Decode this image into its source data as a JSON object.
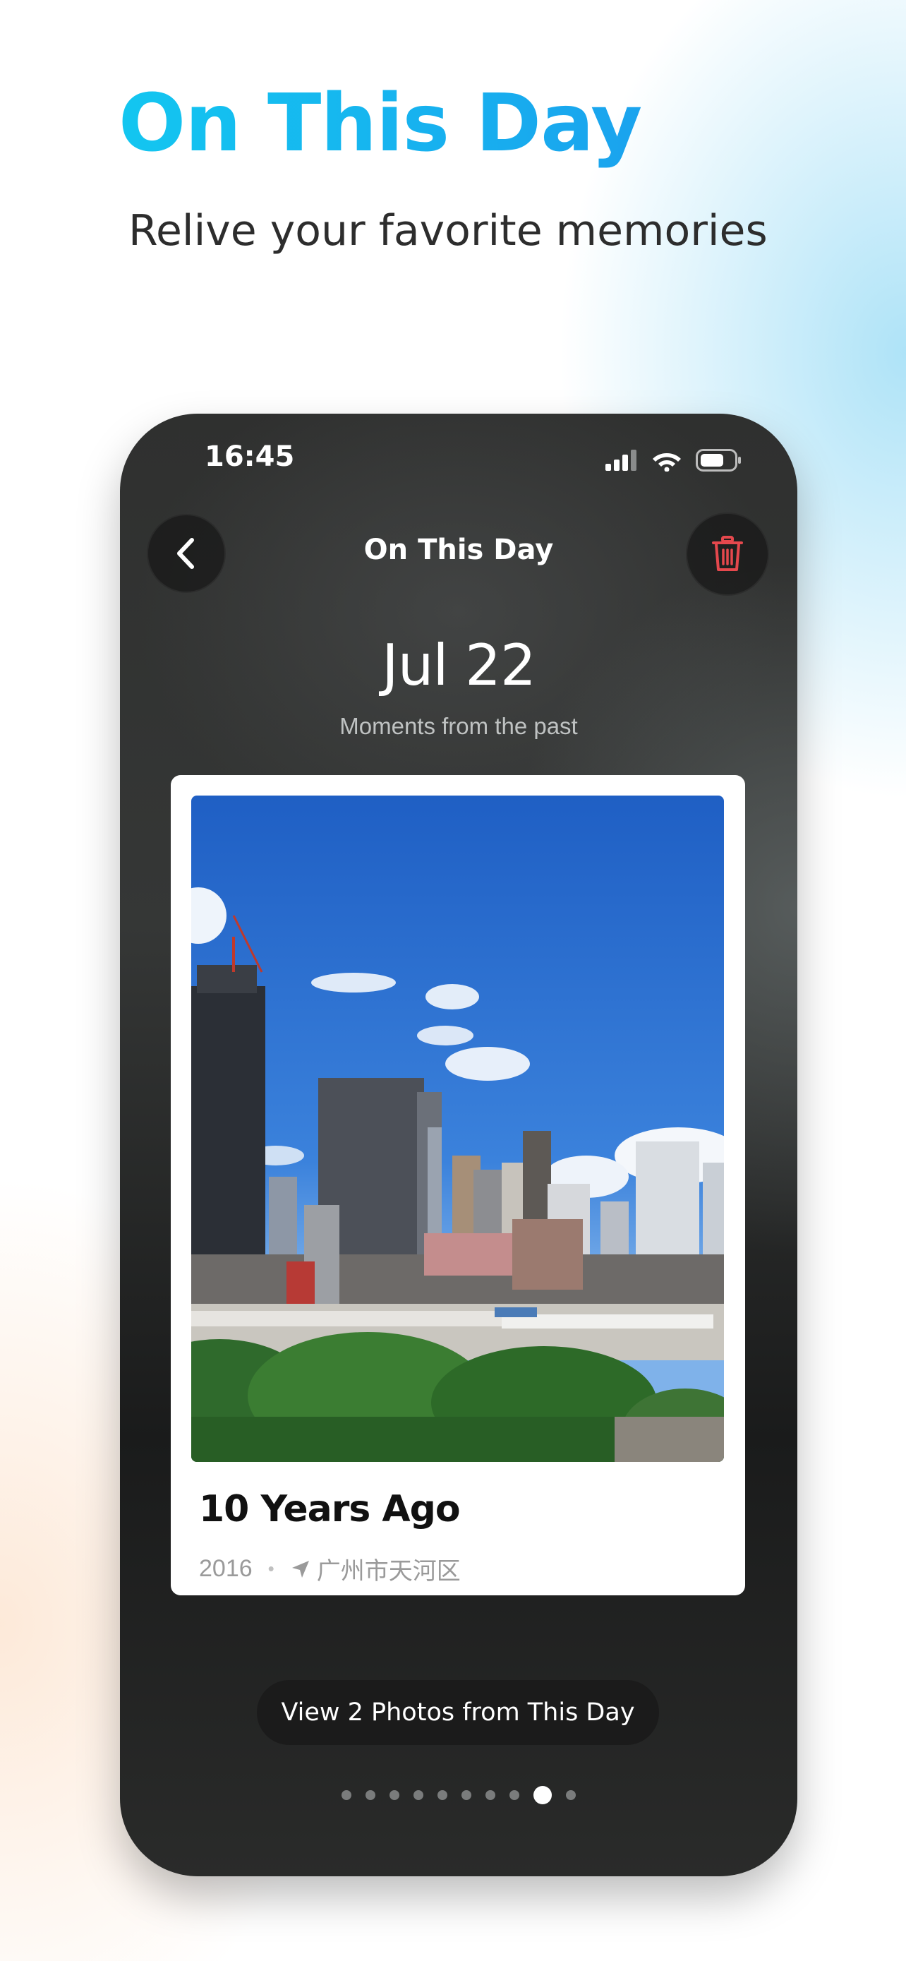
{
  "promo": {
    "headline": "On This Day",
    "tagline": "Relive your favorite memories",
    "headline_colors": [
      "#13c6f0",
      "#1aa3ee"
    ]
  },
  "status_bar": {
    "time": "16:45",
    "icons": [
      "cellular-signal-icon",
      "wifi-icon",
      "battery-icon"
    ]
  },
  "nav": {
    "title": "On This Day",
    "back_icon": "chevron-left-icon",
    "delete_icon": "trash-icon",
    "delete_color": "#e5484d"
  },
  "header": {
    "date": "Jul 22",
    "subtitle": "Moments from the past"
  },
  "memory_card": {
    "title": "10 Years Ago",
    "year": "2016",
    "separator": "•",
    "location_icon": "location-arrow-icon",
    "location": "广州市天河区"
  },
  "view_button": {
    "label": "View 2 Photos from This Day"
  },
  "pager": {
    "count": 10,
    "active_index": 8
  }
}
